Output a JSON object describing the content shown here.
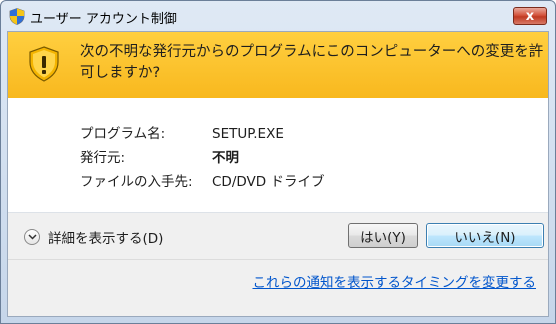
{
  "window": {
    "title": "ユーザー アカウント制御",
    "close_label": "x"
  },
  "banner": {
    "message": "次の不明な発行元からのプログラムにこのコンピューターへの変更を許\n可しますか?"
  },
  "details": {
    "rows": [
      {
        "label": "プログラム名:",
        "value": "SETUP.EXE"
      },
      {
        "label": "発行元:",
        "value": "不明"
      },
      {
        "label": "ファイルの入手先:",
        "value": "CD/DVD ドライブ"
      }
    ]
  },
  "footer": {
    "show_details_label": "詳細を表示する(D)",
    "yes_label": "はい(Y)",
    "no_label": "いいえ(N)",
    "settings_link": "これらの通知を表示するタイミングを変更する"
  },
  "colors": {
    "banner": "#f8b81e",
    "link": "#0055cc",
    "close": "#c03a22"
  }
}
